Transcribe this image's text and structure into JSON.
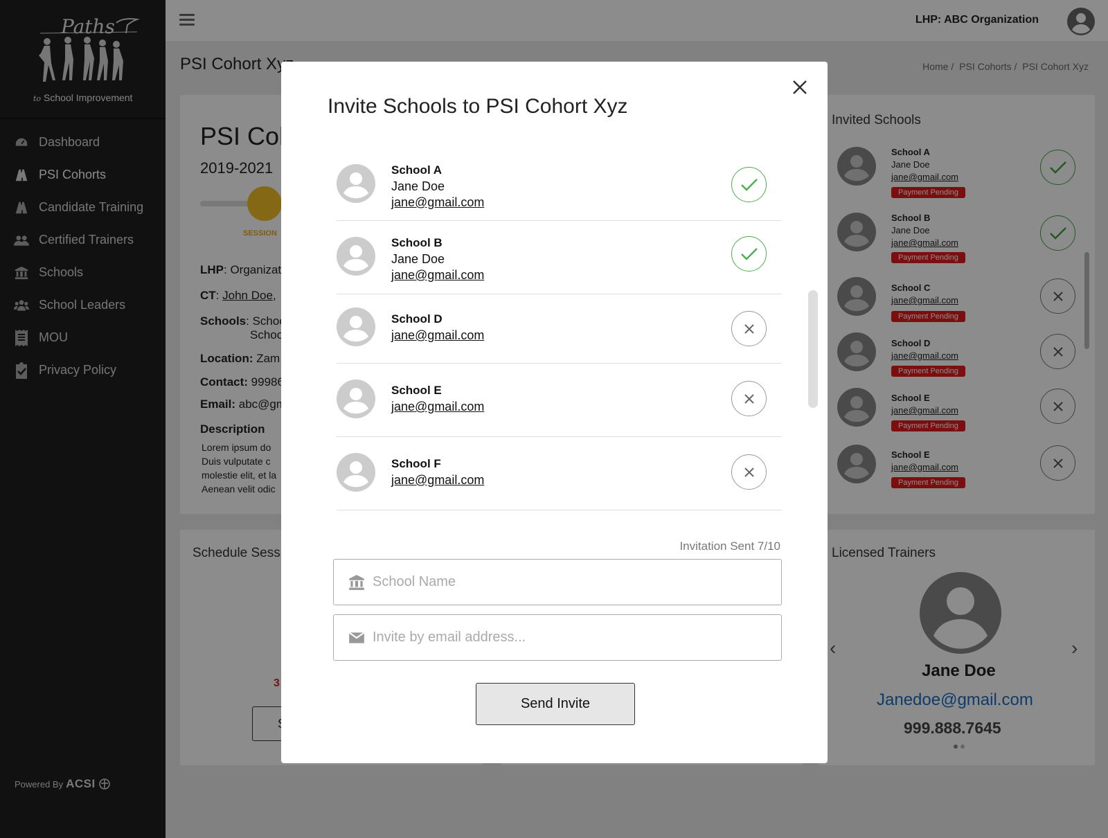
{
  "sidebar": {
    "logo_text": "Paths",
    "logo_sub_prefix": "to",
    "logo_sub": "School Improvement",
    "items": [
      {
        "label": "Dashboard",
        "icon": "dashboard-icon"
      },
      {
        "label": "PSI Cohorts",
        "icon": "road-icon"
      },
      {
        "label": "Candidate Training",
        "icon": "road-icon"
      },
      {
        "label": "Certified Trainers",
        "icon": "users-icon"
      },
      {
        "label": "Schools",
        "icon": "bank-icon"
      },
      {
        "label": "School Leaders",
        "icon": "group-icon"
      },
      {
        "label": "MOU",
        "icon": "receipt-icon"
      },
      {
        "label": "Privacy Policy",
        "icon": "clipboard-check-icon"
      }
    ],
    "powered_by": "Powered By",
    "powered_brand": "ACSI"
  },
  "topbar": {
    "org": "LHP: ABC Organization"
  },
  "page": {
    "title": "PSI Cohort Xyz",
    "breadcrumbs": [
      "Home /",
      "PSI Cohorts /",
      "PSI Cohort Xyz"
    ]
  },
  "cohort": {
    "heading": "PSI Coh",
    "year": "2019-2021",
    "session_label": "SESSION",
    "lhp_label": "LHP",
    "lhp_value": ": Organizat",
    "ct_label": "CT",
    "ct_value": "John Doe",
    "schools_label": "Schools",
    "schools_value_1": ": Schoo",
    "schools_value_2": "Schoo",
    "location_label": "Location:",
    "location_value": " Zam",
    "contact_label": "Contact:",
    "contact_value": " 99986",
    "email_label": "Email:",
    "email_value": " abc@gm",
    "description_label": "Description",
    "description_lines": [
      "Lorem ipsum do",
      "Duis vulputate c",
      "molestie elit, et la",
      "Aenean velit odic"
    ]
  },
  "invited": {
    "title": "Invited Schools",
    "items": [
      {
        "name": "School A",
        "contact": "Jane Doe",
        "email": "jane@gmail.com",
        "badge": "Payment Pending",
        "status": "accepted"
      },
      {
        "name": "School B",
        "contact": "Jane Doe",
        "email": "jane@gmail.com",
        "badge": "Payment Pending",
        "status": "accepted"
      },
      {
        "name": "School C",
        "email": "jane@gmail.com",
        "badge": "Payment Pending",
        "status": "pending"
      },
      {
        "name": "School D",
        "email": "jane@gmail.com",
        "badge": "Payment Pending",
        "status": "pending"
      },
      {
        "name": "School E",
        "email": "jane@gmail.com",
        "badge": "Payment Pending",
        "status": "pending"
      },
      {
        "name": "School E",
        "email": "jane@gmail.com",
        "badge": "Payment Pending",
        "status": "pending"
      }
    ]
  },
  "schedule": {
    "title": "Schedule Sess",
    "red_text": "3",
    "button_text": "S"
  },
  "trainers": {
    "title": "Licensed Trainers",
    "name": "Jane Doe",
    "email": "Janedoe@gmail.com",
    "phone": "999.888.7645"
  },
  "modal": {
    "title": "Invite Schools to PSI Cohort Xyz",
    "rows": [
      {
        "name": "School A",
        "contact": "Jane Doe",
        "email": "jane@gmail.com",
        "status": "accepted"
      },
      {
        "name": "School B",
        "contact": "Jane Doe",
        "email": "jane@gmail.com",
        "status": "accepted"
      },
      {
        "name": "School D",
        "email": "jane@gmail.com",
        "status": "pending"
      },
      {
        "name": "School E",
        "email": "jane@gmail.com",
        "status": "pending"
      },
      {
        "name": "School F",
        "email": "jane@gmail.com",
        "status": "pending"
      }
    ],
    "invitation_sent": "Invitation Sent 7/10",
    "school_name_placeholder": "School Name",
    "email_placeholder": "Invite by email address...",
    "send_button": "Send Invite"
  }
}
